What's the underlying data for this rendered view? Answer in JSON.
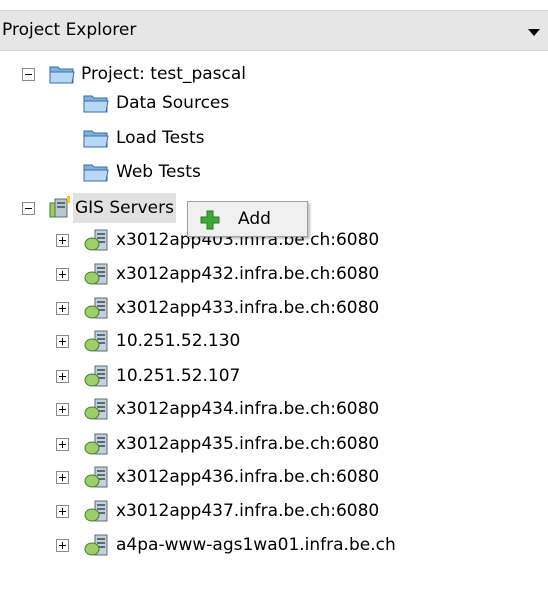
{
  "header": {
    "title": "Project Explorer",
    "dropdown_icon": "chevron-down-icon"
  },
  "project": {
    "label": "Project: test_pascal",
    "children": [
      "Data Sources",
      "Load Tests",
      "Web Tests"
    ]
  },
  "gis": {
    "label": "GIS Servers",
    "servers": [
      "x3012app403.infra.be.ch:6080",
      "x3012app432.infra.be.ch:6080",
      "x3012app433.infra.be.ch:6080",
      "10.251.52.130",
      "10.251.52.107",
      "x3012app434.infra.be.ch:6080",
      "x3012app435.infra.be.ch:6080",
      "x3012app436.infra.be.ch:6080",
      "x3012app437.infra.be.ch:6080",
      "a4pa-www-ags1wa01.infra.be.ch"
    ]
  },
  "context_menu": {
    "add_label": "Add",
    "add_icon": "plus-icon"
  }
}
